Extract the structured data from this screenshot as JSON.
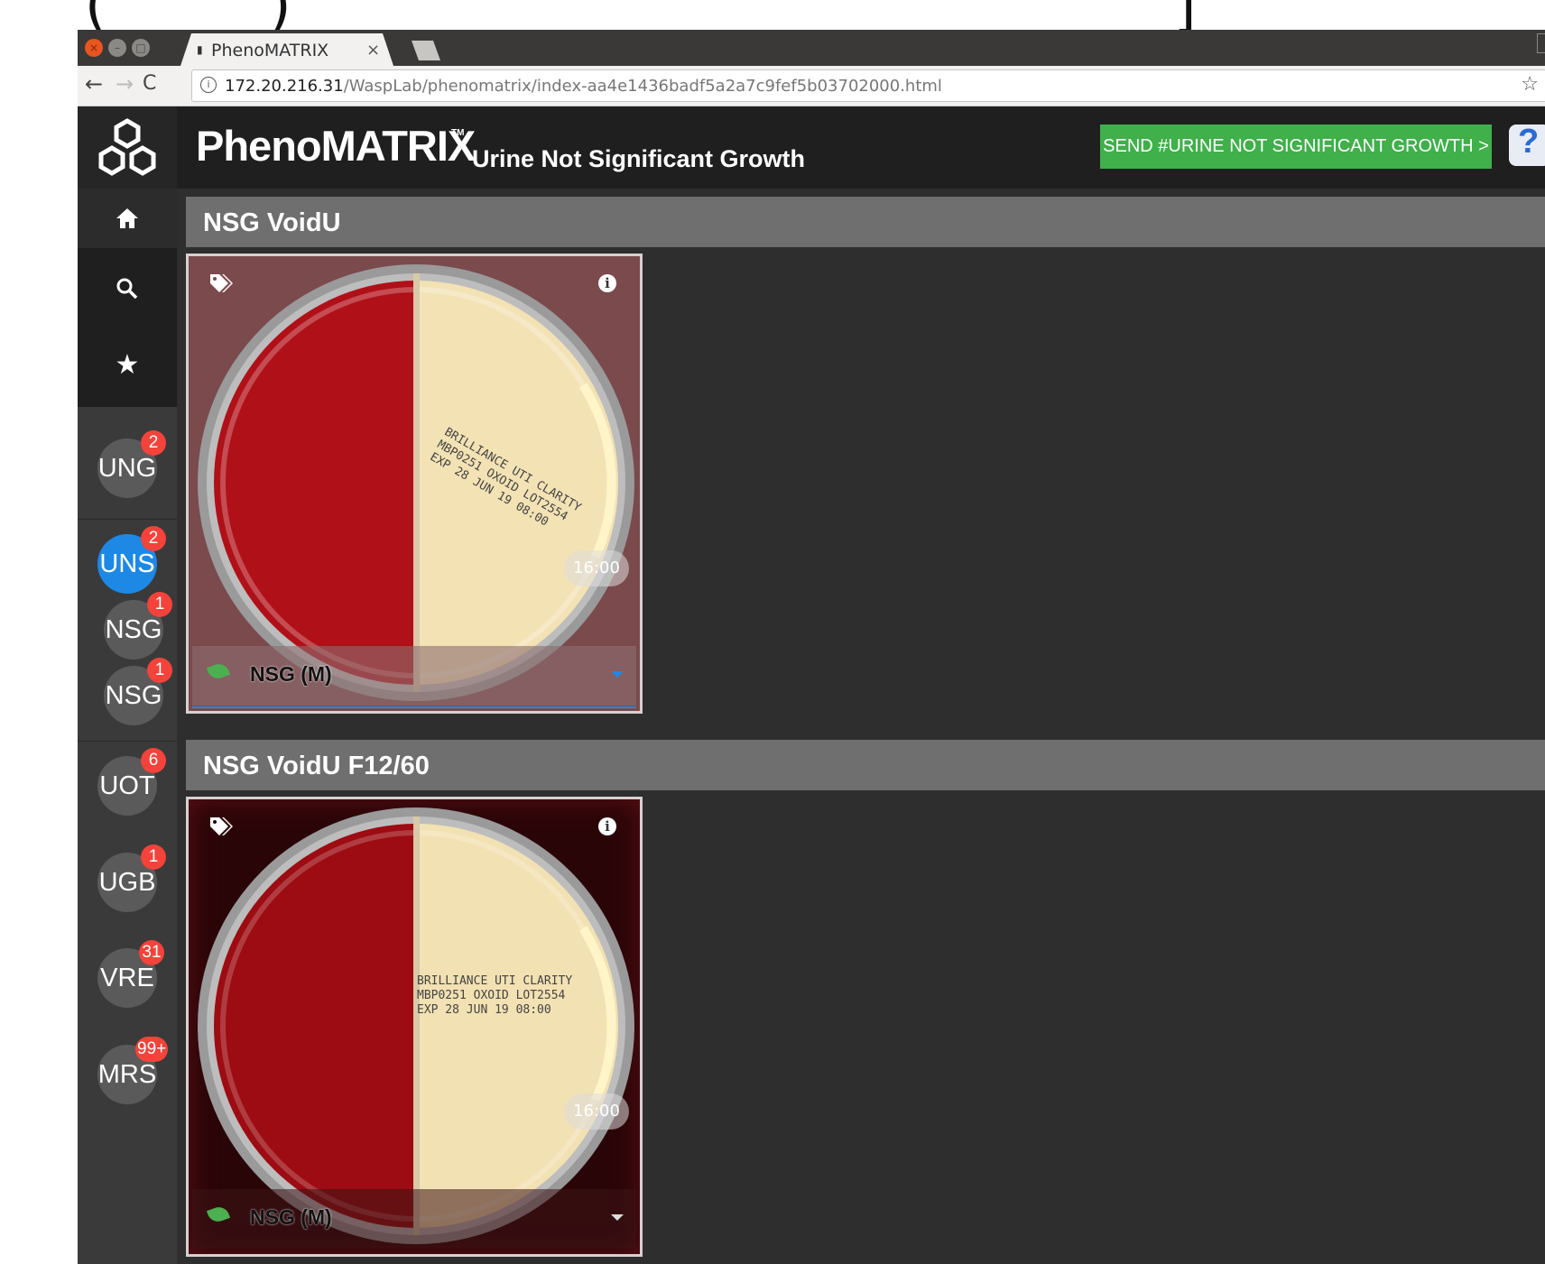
{
  "top_glyphs": {
    "left": "(",
    "middle": ")",
    "right": "]"
  },
  "browser": {
    "tab_title": "PhenoMATRIX",
    "url_host": "172.20.216.31",
    "url_path": "/WaspLab/phenomatrix/index-aa4e1436badf5a2a7c9fef5b03702000.html"
  },
  "header": {
    "brand": "PhenoMATRIX",
    "trademark": "TM",
    "subtitle": "Urine Not Significant Growth",
    "send_button": "SEND #URINE NOT SIGNIFICANT GROWTH >",
    "help_label": "?"
  },
  "sidebar": {
    "queues": [
      {
        "label": "UNG",
        "badge": "2",
        "active": false
      },
      {
        "label": "UNS",
        "badge": "2",
        "active": true
      },
      {
        "label": "NSG",
        "badge": "1",
        "active": false
      },
      {
        "label": "NSG",
        "badge": "1",
        "active": false
      },
      {
        "label": "UOT",
        "badge": "6",
        "active": false
      },
      {
        "label": "UGB",
        "badge": "1",
        "active": false
      },
      {
        "label": "VRE",
        "badge": "31",
        "active": false
      },
      {
        "label": "MRS",
        "badge": "99+",
        "active": false
      }
    ]
  },
  "sections": [
    {
      "title": "NSG VoidU",
      "plate": {
        "time": "16:00",
        "result": "NSG (M)",
        "label_lines": [
          "BRILLIANCE UTI CLARITY",
          "MBP0251 OXOID LOT2554",
          "EXP 28 JUN 19 08:00"
        ]
      }
    },
    {
      "title": "NSG VoidU F12/60",
      "plate": {
        "time": "16:00",
        "result": "NSG (M)",
        "label_lines": [
          "BRILLIANCE UTI CLARITY",
          "MBP0251 OXOID LOT2554",
          "EXP 28 JUN 19 08:00"
        ]
      }
    }
  ],
  "colors": {
    "accent_green": "#3fb04a",
    "active_blue": "#1e88e5",
    "badge_red": "#f4433a"
  }
}
